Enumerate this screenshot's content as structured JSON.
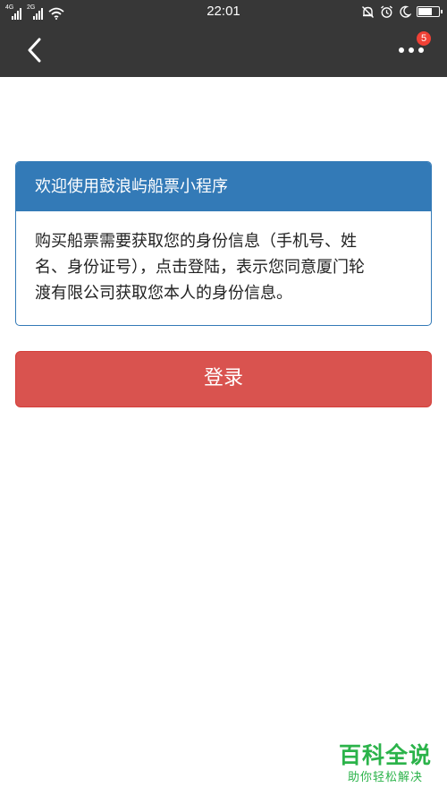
{
  "status_bar": {
    "time": "22:01",
    "signal_1_label": "4G",
    "signal_2_label": "2G",
    "battery_level": 0.72,
    "icons": [
      "signal-icon",
      "signal-icon",
      "wifi-icon",
      "bell-off-icon",
      "alarm-icon",
      "moon-icon",
      "battery-icon"
    ]
  },
  "nav": {
    "back_icon": "chevron-left-icon",
    "more_icon": "more-dots-icon",
    "notification_count": "5"
  },
  "panel": {
    "title": "欢迎使用鼓浪屿船票小程序",
    "body_lines": [
      "购买船票需要获取您的身份信息（手机号、姓",
      "名、身份证号），点击登陆，表示您同意厦门轮",
      "渡有限公司获取您本人的身份信息。"
    ]
  },
  "login_button": {
    "label": "登录"
  },
  "watermark": {
    "title": "百科全说",
    "subtitle": "助你轻松解决"
  },
  "colors": {
    "status_bar": "#373737",
    "panel_primary": "#337ab7",
    "login_red": "#d9534f",
    "badge_red": "#f04136",
    "watermark_green": "#2bb34a"
  }
}
